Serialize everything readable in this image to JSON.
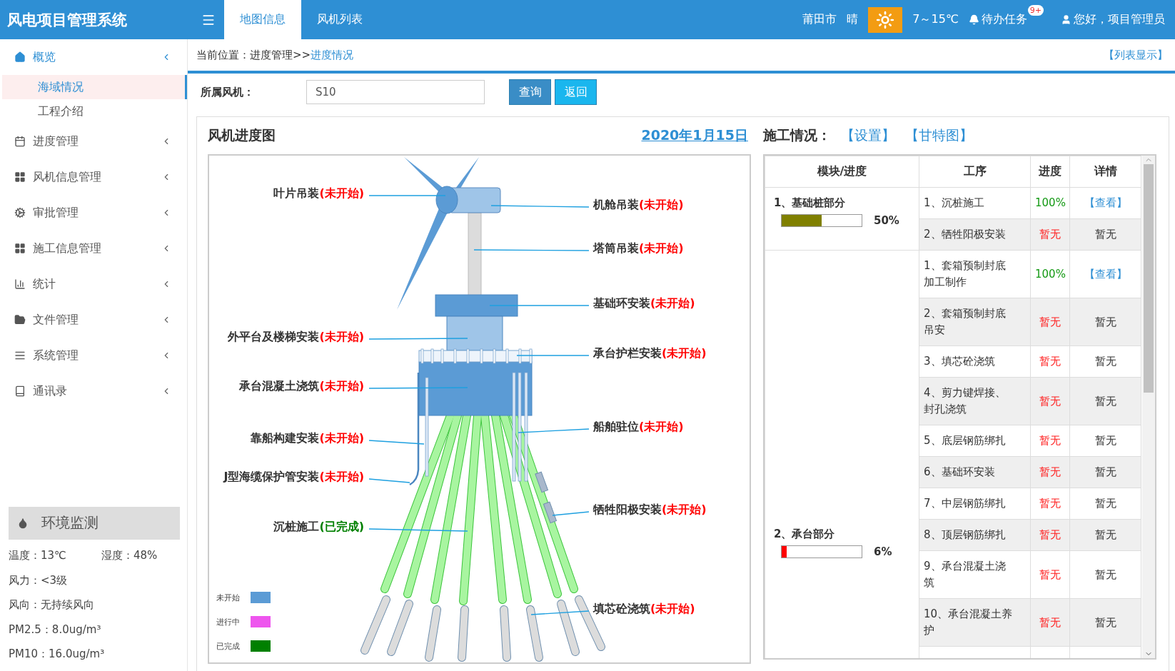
{
  "header": {
    "title": "风电项目管理系统",
    "tabs": [
      {
        "label": "地图信息",
        "selected": true
      },
      {
        "label": "风机列表",
        "selected": false
      }
    ],
    "city": "莆田市",
    "weather": "晴",
    "temperature": "7～15℃",
    "todo": {
      "label": "待办任务",
      "badge": "9+"
    },
    "user": "您好，项目管理员"
  },
  "sidebar": {
    "items": [
      {
        "label": "概览",
        "expanded": true,
        "children": [
          {
            "label": "海域情况",
            "selected": true
          },
          {
            "label": "工程介绍",
            "selected": false
          }
        ]
      },
      {
        "label": "进度管理",
        "expanded": false
      },
      {
        "label": "风机信息管理",
        "expanded": false
      },
      {
        "label": "审批管理",
        "expanded": false
      },
      {
        "label": "施工信息管理",
        "expanded": false
      },
      {
        "label": "统计",
        "expanded": false
      },
      {
        "label": "文件管理",
        "expanded": false
      },
      {
        "label": "系统管理",
        "expanded": false
      },
      {
        "label": "通讯录",
        "expanded": false
      }
    ],
    "env": {
      "title": "环境监测",
      "rows": [
        [
          "温度：13℃",
          "湿度：48%"
        ],
        [
          "风力：<3级"
        ],
        [
          "风向：无持续风向"
        ],
        [
          "PM2.5：8.0ug/m³"
        ],
        [
          "PM10：16.0ug/m³"
        ]
      ]
    }
  },
  "breadcrumb": {
    "prefix": "当前位置：进度管理>>",
    "current": "进度情况",
    "list_link": "【列表显示】"
  },
  "filter": {
    "label": "所属风机：",
    "value": "S10",
    "buttons": [
      {
        "label": "查询",
        "kind": "primary"
      },
      {
        "label": "返回",
        "kind": "secondary"
      }
    ]
  },
  "diagram": {
    "title": "风机进度图",
    "date": "2020年1月15日",
    "labels": [
      {
        "name": "叶片吊装",
        "status_text": "(未开始)",
        "kind": "pending"
      },
      {
        "name": "外平台及楼梯安装",
        "status_text": "(未开始)",
        "kind": "pending"
      },
      {
        "name": "承台混凝土浇筑",
        "status_text": "(未开始)",
        "kind": "pending"
      },
      {
        "name": "靠船构建安装",
        "status_text": "(未开始)",
        "kind": "pending"
      },
      {
        "name": "J型海缆保护管安装",
        "status_text": "(未开始)",
        "kind": "pending"
      },
      {
        "name": "沉桩施工",
        "status_text": "(已完成)",
        "kind": "done"
      },
      {
        "name": "机舱吊装",
        "status_text": "(未开始)",
        "kind": "pending"
      },
      {
        "name": "塔筒吊装",
        "status_text": "(未开始)",
        "kind": "pending"
      },
      {
        "name": "基础环安装",
        "status_text": "(未开始)",
        "kind": "pending"
      },
      {
        "name": "承台护栏安装",
        "status_text": "(未开始)",
        "kind": "pending"
      },
      {
        "name": "船舶驻位",
        "status_text": "(未开始)",
        "kind": "pending"
      },
      {
        "name": "牺牲阳极安装",
        "status_text": "(未开始)",
        "kind": "pending"
      },
      {
        "name": "填芯砼浇筑",
        "status_text": "(未开始)",
        "kind": "pending"
      }
    ],
    "legend": [
      {
        "label": "未开始",
        "color": "#5b9bd5"
      },
      {
        "label": "进行中",
        "color": "#ee55ee"
      },
      {
        "label": "已完成",
        "color": "#008000"
      }
    ]
  },
  "construction": {
    "title": "施工情况：",
    "links": [
      "【设置】",
      "【甘特图】"
    ],
    "columns": [
      "模块/进度",
      "工序",
      "进度",
      "详情"
    ],
    "modules": [
      {
        "name": "1、基础桩部分",
        "progress": "50%",
        "level": 0.5,
        "color": "#808000",
        "steps": [
          {
            "name": "1、沉桩施工",
            "progress": "100%",
            "kind": "done",
            "detail": {
              "label": "【查看】",
              "kind": "link"
            }
          },
          {
            "name": "2、牺牲阳极安装",
            "progress": "暂无",
            "kind": "none",
            "detail": {
              "label": "暂无",
              "kind": "text"
            }
          }
        ]
      },
      {
        "name": "2、承台部分",
        "progress": "6%",
        "level": 0.06,
        "color": "#ff0000",
        "steps": [
          {
            "name": "1、套箱预制封底加工制作",
            "progress": "100%",
            "kind": "done",
            "detail": {
              "label": "【查看】",
              "kind": "link"
            }
          },
          {
            "name": "2、套箱预制封底吊安",
            "progress": "暂无",
            "kind": "none",
            "detail": {
              "label": "暂无",
              "kind": "text"
            }
          },
          {
            "name": "3、填芯砼浇筑",
            "progress": "暂无",
            "kind": "none",
            "detail": {
              "label": "暂无",
              "kind": "text"
            }
          },
          {
            "name": "4、剪力键焊接、封孔浇筑",
            "progress": "暂无",
            "kind": "none",
            "detail": {
              "label": "暂无",
              "kind": "text"
            }
          },
          {
            "name": "5、底层钢筋绑扎",
            "progress": "暂无",
            "kind": "none",
            "detail": {
              "label": "暂无",
              "kind": "text"
            }
          },
          {
            "name": "6、基础环安装",
            "progress": "暂无",
            "kind": "none",
            "detail": {
              "label": "暂无",
              "kind": "text"
            }
          },
          {
            "name": "7、中层钢筋绑扎",
            "progress": "暂无",
            "kind": "none",
            "detail": {
              "label": "暂无",
              "kind": "text"
            }
          },
          {
            "name": "8、顶层钢筋绑扎",
            "progress": "暂无",
            "kind": "none",
            "detail": {
              "label": "暂无",
              "kind": "text"
            }
          },
          {
            "name": "9、承台混凝土浇筑",
            "progress": "暂无",
            "kind": "none",
            "detail": {
              "label": "暂无",
              "kind": "text"
            }
          },
          {
            "name": "10、承台混凝土养护",
            "progress": "暂无",
            "kind": "none",
            "detail": {
              "label": "暂无",
              "kind": "text"
            }
          }
        ]
      }
    ]
  }
}
